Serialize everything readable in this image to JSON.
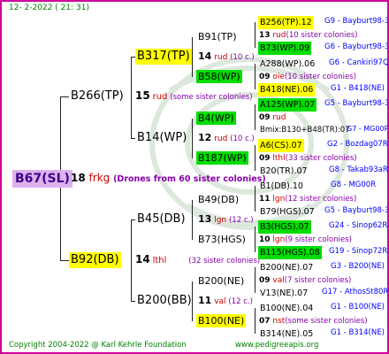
{
  "header": {
    "date_stamp": "12-  2-2022 (  21:  31)"
  },
  "footer": {
    "copyright": "Copyright 2004-2022 @ Karl Kehrle Foundation",
    "url": "www.pedigreeapis.org"
  },
  "root": {
    "name": "B67(SL)",
    "num": "18",
    "code": "frkg",
    "note": "(Drones from 60 sister colonies)"
  },
  "gen1": [
    {
      "name": "B266(TP)",
      "num": "15",
      "code": "rud",
      "note": "(some sister colonies)"
    },
    {
      "name": "B92(DB)",
      "num": "14",
      "code": "lthl",
      "note": "(32 sister colonies)"
    }
  ],
  "gen2": [
    {
      "name": "B317(TP)",
      "num": "14",
      "code": "rud",
      "note": "(10 c.)"
    },
    {
      "name": "B14(WP)",
      "num": "12",
      "code": "rud",
      "note": "(10 c.)"
    },
    {
      "name": "B45(DB)",
      "num": "13",
      "code": "lgn",
      "note": "(12 c.)"
    },
    {
      "name": "B200(BB)",
      "num": "11",
      "code": "val",
      "note": "(12 c.)"
    }
  ],
  "gen3": [
    {
      "name": "B91(TP)",
      "num": "13",
      "code": "rud",
      "note": "(10 sister colonies)",
      "a": "B256(TP).12",
      "a_loc": "G9 - Bayburt98-3",
      "b": "B73(WP).09",
      "b_loc": "G6 - Bayburt98-3"
    },
    {
      "name": "B58(WP)",
      "num": "09",
      "code": "oie",
      "note": "(10 sister colonies)",
      "a": "A288(WP).06",
      "a_loc": "G6 - Cankiri97Q",
      "b": "B418(NE).06",
      "b_loc": "G1 - B418(NE)"
    },
    {
      "name": "B4(WP)",
      "num": "09",
      "code": "rud",
      "note": "",
      "a": "A125(WP).07",
      "a_loc": "G5 - Bayburt98-3",
      "b": "Bmix:B130+B48(TR):07",
      "b_loc": "G7 - MG00R"
    },
    {
      "name": "B187(WP)",
      "num": "09",
      "code": "lthl",
      "note": "(33 sister colonies)",
      "a": "A6(CS).07",
      "a_loc": "G2 - Bozdag07R",
      "b": "B20(TR).07",
      "b_loc": "G8 - Takab93aR"
    },
    {
      "name": "B49(DB)",
      "num": "11",
      "code": "lgn",
      "note": "(12 sister colonies)",
      "a": "B1(DB).10",
      "a_loc": "G8 - MG00R",
      "b": "B79(HGS).07",
      "b_loc": "G5 - Bayburt98-3"
    },
    {
      "name": "B73(HGS)",
      "num": "10",
      "code": "lgn",
      "note": "(9 sister colonies)",
      "a": "B3(HGS).07",
      "a_loc": "G24 - Sinop62R",
      "b": "B115(HGS).08",
      "b_loc": "G19 - Sinop72R"
    },
    {
      "name": "B200(NE)",
      "num": "09",
      "code": "val",
      "note": "(7 sister colonies)",
      "a": "B200(NE).07",
      "a_loc": "G3 - B200(NE)",
      "b": "V13(NE).07",
      "b_loc": "G17 - AthosSt80R"
    },
    {
      "name": "B100(NE)",
      "num": "07",
      "code": "nst",
      "note": "(some sister colonies)",
      "a": "B100(NE).04",
      "a_loc": "G1 - B100(NE)",
      "b": "B314(NE).05",
      "b_loc": "G1 - B314(NE)"
    }
  ],
  "colors": {
    "border": "#cc0099",
    "queen_highlight_yellow": "#ffff00",
    "queen_highlight_green": "#00dd00",
    "root_bg": "#ddb0ee"
  }
}
